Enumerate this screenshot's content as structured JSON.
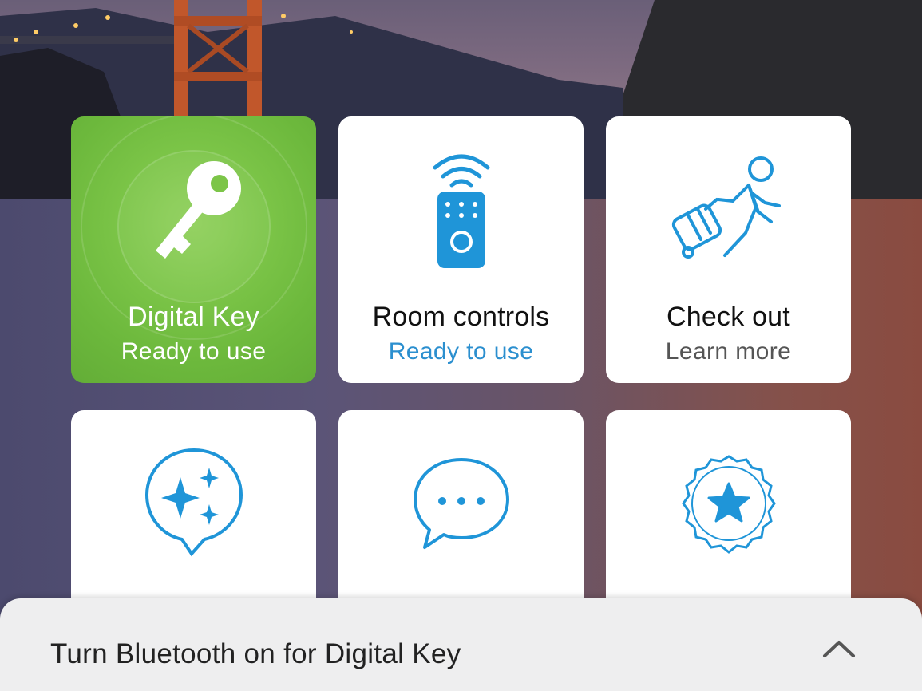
{
  "tiles": [
    {
      "title": "Digital Key",
      "subtitle": "Ready to use",
      "icon": "key-icon"
    },
    {
      "title": "Room controls",
      "subtitle": "Ready to use",
      "icon": "remote-control-icon"
    },
    {
      "title": "Check out",
      "subtitle": "Learn more",
      "icon": "traveler-luggage-icon"
    },
    {
      "icon": "sparkle-chat-icon"
    },
    {
      "icon": "chat-bubble-icon"
    },
    {
      "icon": "star-badge-icon"
    }
  ],
  "bluetooth_banner": {
    "text": "Turn Bluetooth on for Digital Key",
    "icon": "chevron-up-icon"
  },
  "colors": {
    "accent_blue": "#2b8fcf",
    "icon_blue": "#1f95d8",
    "key_green": "#7cc548"
  }
}
